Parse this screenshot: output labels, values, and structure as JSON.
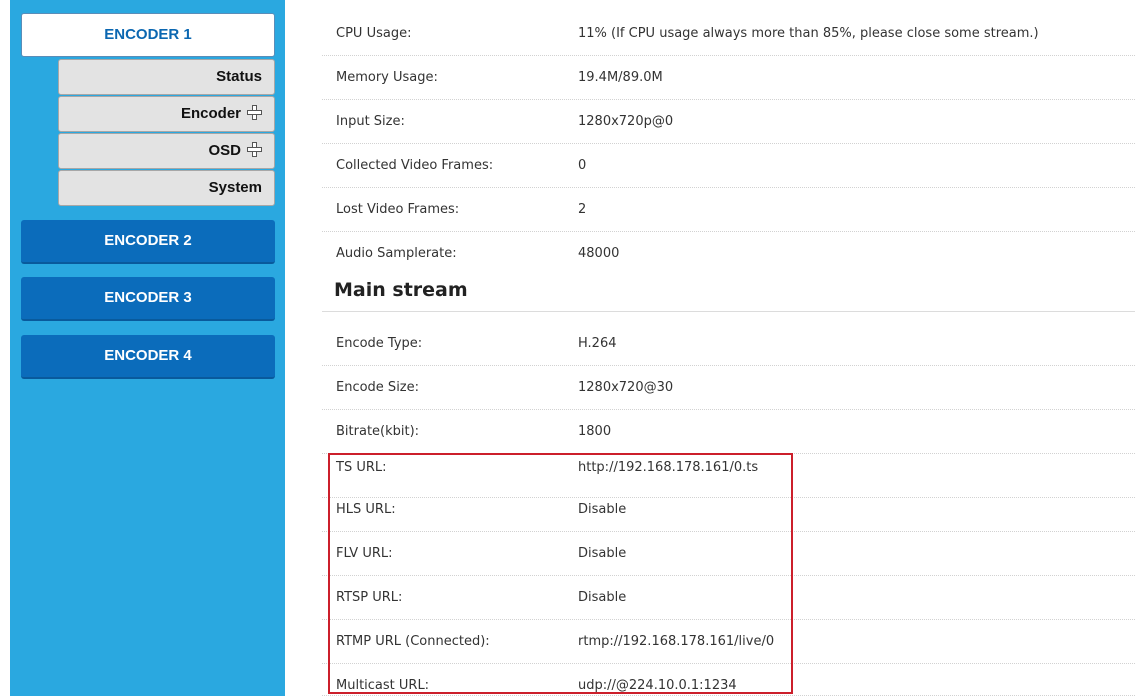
{
  "sidebar": {
    "encoders": [
      {
        "label": "ENCODER 1",
        "active": true
      },
      {
        "label": "ENCODER 2",
        "active": false
      },
      {
        "label": "ENCODER 3",
        "active": false
      },
      {
        "label": "ENCODER 4",
        "active": false
      }
    ],
    "submenu": [
      {
        "label": "Status",
        "icon": null
      },
      {
        "label": "Encoder",
        "icon": "plus-icon"
      },
      {
        "label": "OSD",
        "icon": "plus-icon"
      },
      {
        "label": "System",
        "icon": null
      }
    ]
  },
  "status": {
    "rows": [
      {
        "label": "CPU Usage:",
        "value": "11% (If CPU usage always more than 85%, please close some stream.)"
      },
      {
        "label": "Memory Usage:",
        "value": "19.4M/89.0M"
      },
      {
        "label": "Input Size:",
        "value": "1280x720p@0"
      },
      {
        "label": "Collected Video Frames:",
        "value": "0"
      },
      {
        "label": "Lost Video Frames:",
        "value": "2"
      },
      {
        "label": "Audio Samplerate:",
        "value": "48000"
      }
    ]
  },
  "main_stream": {
    "title": "Main stream",
    "rows": [
      {
        "label": "Encode Type:",
        "value": "H.264"
      },
      {
        "label": "Encode Size:",
        "value": "1280x720@30"
      },
      {
        "label": "Bitrate(kbit):",
        "value": "1800"
      },
      {
        "label": "TS URL:",
        "value": "http://192.168.178.161/0.ts"
      },
      {
        "label": "HLS URL:",
        "value": "Disable"
      },
      {
        "label": "FLV URL:",
        "value": "Disable"
      },
      {
        "label": "RTSP URL:",
        "value": "Disable"
      },
      {
        "label": "RTMP URL (Connected):",
        "value": "rtmp://192.168.178.161/live/0"
      },
      {
        "label": "Multicast URL:",
        "value": "udp://@224.10.0.1:1234"
      }
    ]
  },
  "colors": {
    "sidebar_bg": "#2aa8e0",
    "encoder_inactive_bg": "#0b6cbb",
    "encoder_active_text": "#0b67b1",
    "highlight_border": "#cc1f2b"
  }
}
